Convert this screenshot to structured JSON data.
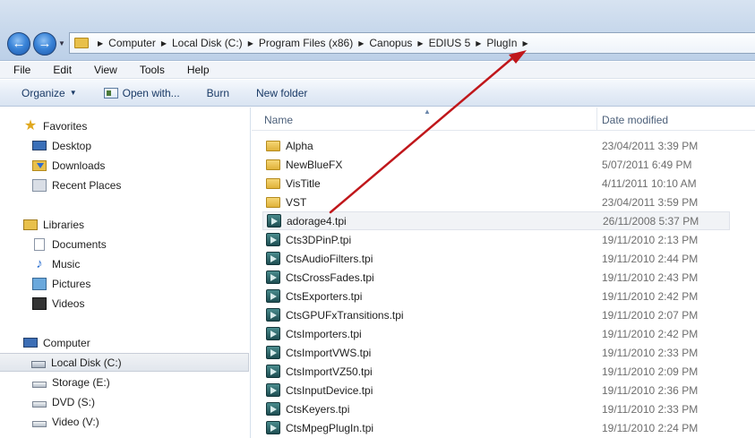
{
  "address_bar": {
    "breadcrumbs": [
      "Computer",
      "Local Disk (C:)",
      "Program Files (x86)",
      "Canopus",
      "EDIUS 5",
      "PlugIn"
    ]
  },
  "menu": [
    "File",
    "Edit",
    "View",
    "Tools",
    "Help"
  ],
  "toolbar": {
    "organize": "Organize",
    "open_with": "Open with...",
    "burn": "Burn",
    "new_folder": "New folder"
  },
  "navigation": {
    "favorites": {
      "label": "Favorites",
      "items": [
        "Desktop",
        "Downloads",
        "Recent Places"
      ]
    },
    "libraries": {
      "label": "Libraries",
      "items": [
        "Documents",
        "Music",
        "Pictures",
        "Videos"
      ]
    },
    "computer": {
      "label": "Computer",
      "items": [
        "Local Disk (C:)",
        "Storage (E:)",
        "DVD (S:)",
        "Video (V:)"
      ],
      "selected": "Local Disk (C:)"
    }
  },
  "columns": {
    "name": "Name",
    "date_modified": "Date modified"
  },
  "files": [
    {
      "name": "Alpha",
      "date": "23/04/2011 3:39 PM",
      "type": "folder"
    },
    {
      "name": "NewBlueFX",
      "date": "5/07/2011 6:49 PM",
      "type": "folder"
    },
    {
      "name": "VisTitle",
      "date": "4/11/2011 10:10 AM",
      "type": "folder"
    },
    {
      "name": "VST",
      "date": "23/04/2011 3:59 PM",
      "type": "folder"
    },
    {
      "name": "adorage4.tpi",
      "date": "26/11/2008 5:37 PM",
      "type": "tpi"
    },
    {
      "name": "Cts3DPinP.tpi",
      "date": "19/11/2010 2:13 PM",
      "type": "tpi"
    },
    {
      "name": "CtsAudioFilters.tpi",
      "date": "19/11/2010 2:44 PM",
      "type": "tpi"
    },
    {
      "name": "CtsCrossFades.tpi",
      "date": "19/11/2010 2:43 PM",
      "type": "tpi"
    },
    {
      "name": "CtsExporters.tpi",
      "date": "19/11/2010 2:42 PM",
      "type": "tpi"
    },
    {
      "name": "CtsGPUFxTransitions.tpi",
      "date": "19/11/2010 2:07 PM",
      "type": "tpi"
    },
    {
      "name": "CtsImporters.tpi",
      "date": "19/11/2010 2:42 PM",
      "type": "tpi"
    },
    {
      "name": "CtsImportVWS.tpi",
      "date": "19/11/2010 2:33 PM",
      "type": "tpi"
    },
    {
      "name": "CtsImportVZ50.tpi",
      "date": "19/11/2010 2:09 PM",
      "type": "tpi"
    },
    {
      "name": "CtsInputDevice.tpi",
      "date": "19/11/2010 2:36 PM",
      "type": "tpi"
    },
    {
      "name": "CtsKeyers.tpi",
      "date": "19/11/2010 2:33 PM",
      "type": "tpi"
    },
    {
      "name": "CtsMpegPlugIn.tpi",
      "date": "19/11/2010 2:24 PM",
      "type": "tpi"
    }
  ],
  "annotation": {
    "color": "#c0171b",
    "from_item": "adorage4.tpi",
    "to_item": "PlugIn"
  }
}
